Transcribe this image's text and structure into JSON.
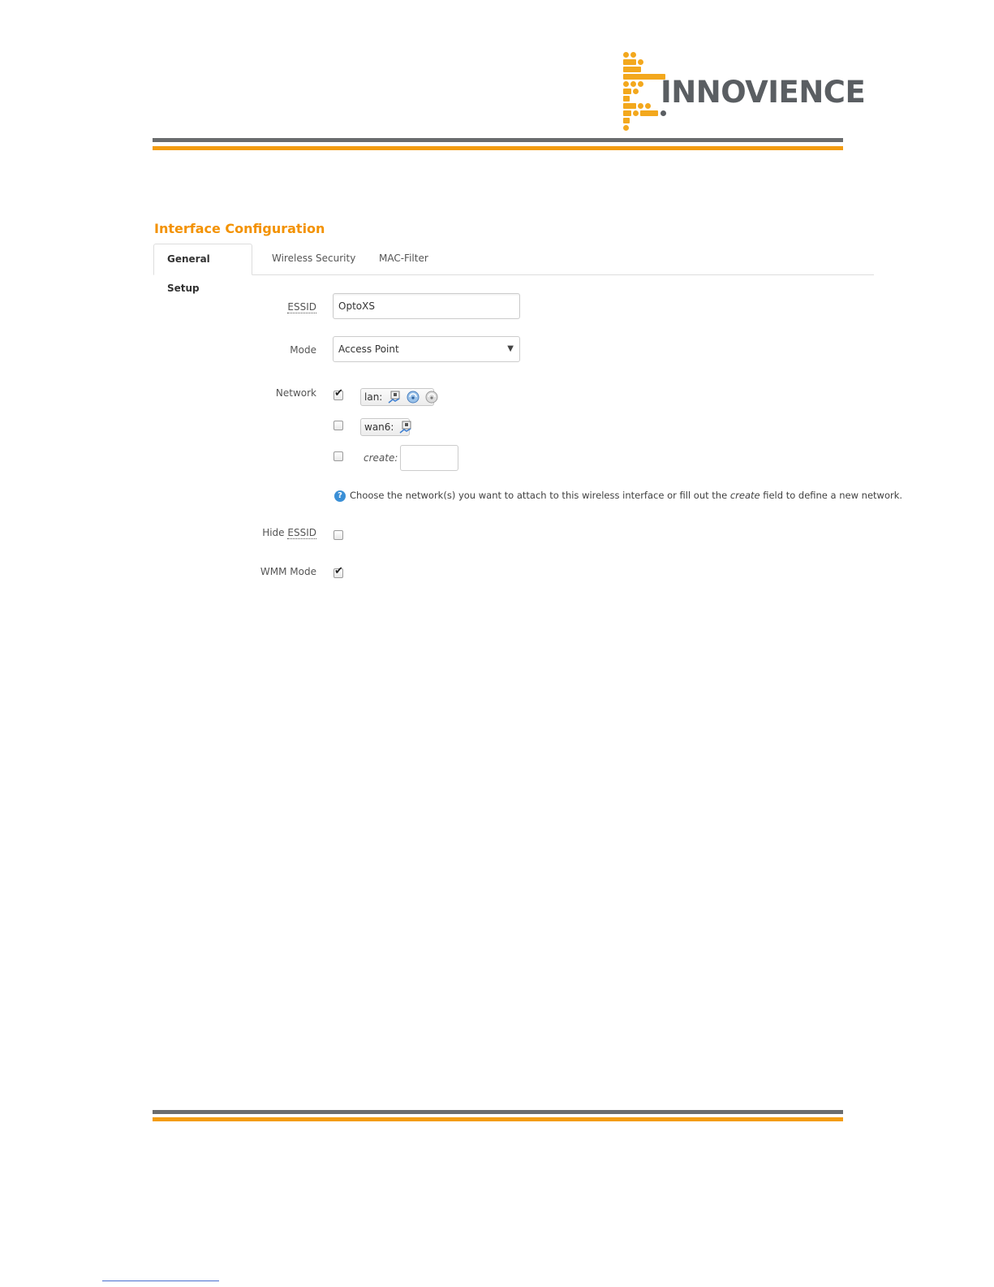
{
  "brand": {
    "logo_text": "INNOVIENCE",
    "colors": {
      "accent_orange": "#f39c12",
      "logo_gray": "#5a5e62",
      "title_orange": "#f39200"
    }
  },
  "section": {
    "title": "Interface Configuration"
  },
  "tabs": [
    {
      "label": "General Setup",
      "active": true
    },
    {
      "label": "Wireless Security",
      "active": false
    },
    {
      "label": "MAC-Filter",
      "active": false
    }
  ],
  "form": {
    "essid": {
      "label": "ESSID",
      "value": "OptoXS"
    },
    "mode": {
      "label": "Mode",
      "value": "Access Point"
    },
    "network": {
      "label": "Network",
      "options": [
        {
          "name": "lan:",
          "checked": true,
          "icons": [
            "ethernet-icon",
            "wifi-icon",
            "wifi-icon"
          ]
        },
        {
          "name": "wan6:",
          "checked": false,
          "icons": [
            "ethernet-icon"
          ]
        }
      ],
      "create_label": "create:",
      "create_value": "",
      "create_checked": false,
      "help_pre": "Choose the network(s) you want to attach to this wireless interface or fill out the",
      "help_em": "create",
      "help_post": "field to define a new network."
    },
    "hide_essid": {
      "label_pre": "Hide",
      "label_abbr": "ESSID",
      "checked": false
    },
    "wmm_mode": {
      "label": "WMM Mode",
      "checked": true
    }
  }
}
